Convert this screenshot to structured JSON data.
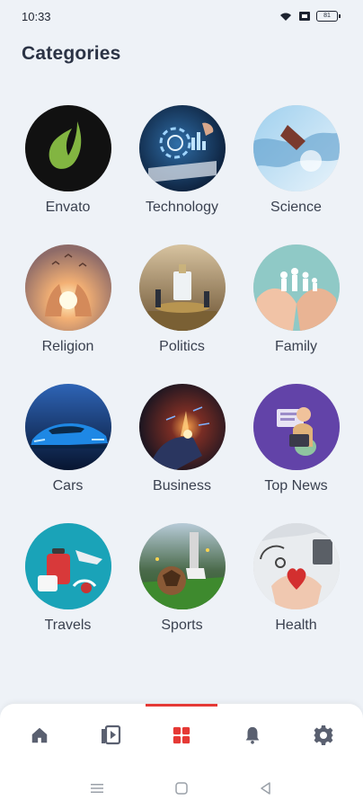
{
  "status_bar": {
    "time": "10:33",
    "battery": "81",
    "icons": [
      "wifi-icon",
      "screen-icon",
      "battery-icon"
    ]
  },
  "page": {
    "title": "Categories"
  },
  "categories": [
    {
      "label": "Envato",
      "icon": "envato-leaf-logo"
    },
    {
      "label": "Technology",
      "icon": "technology-image"
    },
    {
      "label": "Science",
      "icon": "science-image"
    },
    {
      "label": "Religion",
      "icon": "religion-image"
    },
    {
      "label": "Politics",
      "icon": "politics-image"
    },
    {
      "label": "Family",
      "icon": "family-image"
    },
    {
      "label": "Cars",
      "icon": "cars-image"
    },
    {
      "label": "Business",
      "icon": "business-image"
    },
    {
      "label": "Top News",
      "icon": "top-news-image"
    },
    {
      "label": "Travels",
      "icon": "travels-image"
    },
    {
      "label": "Sports",
      "icon": "sports-image"
    },
    {
      "label": "Health",
      "icon": "health-image"
    }
  ],
  "bottom_nav": {
    "items": [
      {
        "icon": "home-icon",
        "active": false
      },
      {
        "icon": "video-icon",
        "active": false
      },
      {
        "icon": "categories-grid-icon",
        "active": true
      },
      {
        "icon": "bell-icon",
        "active": false
      },
      {
        "icon": "settings-gear-icon",
        "active": false
      }
    ],
    "active_color": "#e53935",
    "inactive_color": "#5a6070"
  },
  "system_nav": [
    "menu-icon",
    "home-square-icon",
    "back-triangle-icon"
  ]
}
